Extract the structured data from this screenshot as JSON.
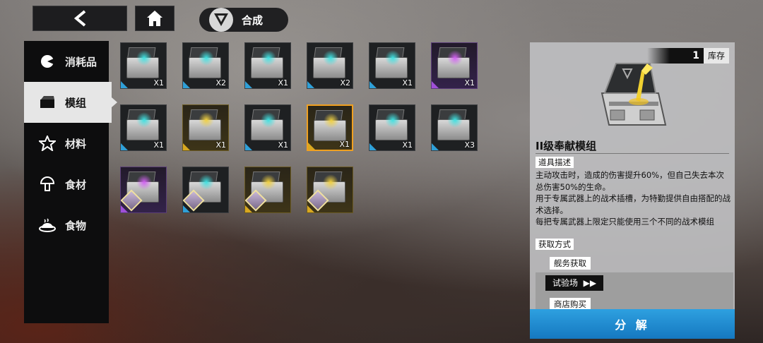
{
  "header": {
    "title": "合成"
  },
  "sidebar": {
    "items": [
      {
        "label": "消耗品",
        "icon": "pie-icon",
        "active": false
      },
      {
        "label": "模组",
        "icon": "box-icon",
        "active": true
      },
      {
        "label": "材料",
        "icon": "star-icon",
        "active": false
      },
      {
        "label": "食材",
        "icon": "mushroom-icon",
        "active": false
      },
      {
        "label": "食物",
        "icon": "dish-icon",
        "active": false
      }
    ]
  },
  "grid": {
    "items": [
      {
        "qty": "X1",
        "rarity": "blue",
        "glow": "#3fe0e0"
      },
      {
        "qty": "X2",
        "rarity": "blue",
        "glow": "#3fe0e0"
      },
      {
        "qty": "X1",
        "rarity": "blue",
        "glow": "#3fe0e0"
      },
      {
        "qty": "X2",
        "rarity": "blue",
        "glow": "#3fe0e0"
      },
      {
        "qty": "X1",
        "rarity": "blue",
        "glow": "#3fe0e0"
      },
      {
        "qty": "X1",
        "rarity": "purple",
        "glow": "#d060f0"
      },
      {
        "qty": "X1",
        "rarity": "blue",
        "glow": "#3fe0e0"
      },
      {
        "qty": "X1",
        "rarity": "gold",
        "glow": "#f0d040"
      },
      {
        "qty": "X1",
        "rarity": "blue",
        "glow": "#3fe0e0"
      },
      {
        "qty": "X1",
        "rarity": "gold",
        "glow": "#f0d040",
        "selected": true
      },
      {
        "qty": "X1",
        "rarity": "blue",
        "glow": "#3fe0e0"
      },
      {
        "qty": "X3",
        "rarity": "blue",
        "glow": "#3fe0e0"
      },
      {
        "qty": "",
        "rarity": "purple",
        "glow": "#d060f0",
        "portrait": true
      },
      {
        "qty": "",
        "rarity": "blue",
        "glow": "#3fe0e0",
        "portrait": true
      },
      {
        "qty": "",
        "rarity": "gold",
        "glow": "#f0d040",
        "portrait": true
      },
      {
        "qty": "",
        "rarity": "gold",
        "glow": "#f0d040",
        "portrait": true
      }
    ]
  },
  "detail": {
    "stock_count": "1",
    "stock_label": "库存",
    "name": "II级奉献模组",
    "desc_label": "道具描述",
    "description": "主动攻击时，造成的伤害提升60%，但自己失去本次总伤害50%的生命。\n用于专属武器上的战术插槽，为特勤提供自由搭配的战术选择。\n每把专属武器上限定只能使用三个不同的战术模组",
    "acquire_label": "获取方式",
    "acquire_items": [
      "舰务获取",
      "试验场",
      "商店购买"
    ],
    "decompose_label": "分 解"
  }
}
